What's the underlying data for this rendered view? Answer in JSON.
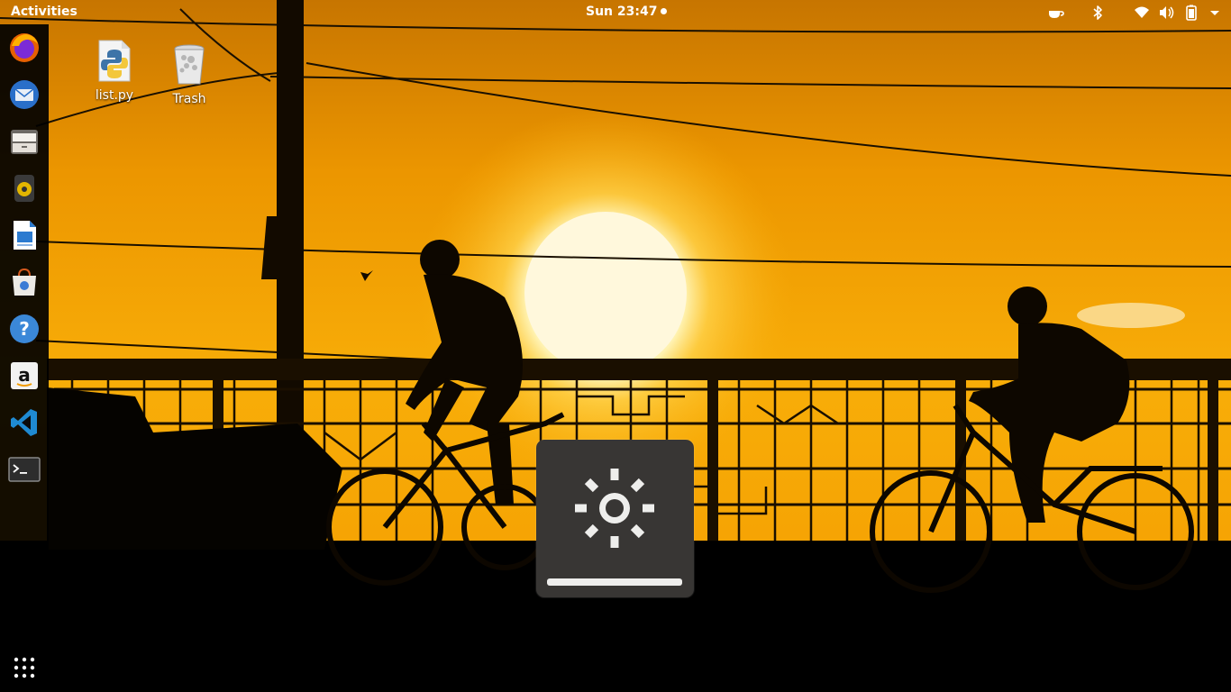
{
  "topbar": {
    "activities_label": "Activities",
    "clock": "Sun 23:47",
    "tray_icons": [
      "coffee-cup-icon",
      "bluetooth-icon",
      "wifi-icon",
      "volume-icon",
      "battery-icon",
      "system-menu-arrow-icon"
    ]
  },
  "dock": {
    "items": [
      {
        "name": "firefox",
        "icon": "firefox-icon"
      },
      {
        "name": "thunderbird",
        "icon": "thunderbird-mail-icon"
      },
      {
        "name": "files",
        "icon": "file-cabinet-icon"
      },
      {
        "name": "rhythmbox",
        "icon": "speaker-icon"
      },
      {
        "name": "libreoffice-writer",
        "icon": "document-writer-icon"
      },
      {
        "name": "software",
        "icon": "software-bag-icon"
      },
      {
        "name": "help",
        "icon": "help-question-icon"
      },
      {
        "name": "amazon",
        "icon": "amazon-icon"
      },
      {
        "name": "vscode",
        "icon": "vscode-icon"
      },
      {
        "name": "terminal",
        "icon": "terminal-icon"
      }
    ],
    "show_apps_icon": "app-grid-icon"
  },
  "desktop": {
    "icons": [
      {
        "label": "list.py",
        "icon": "python-file-icon"
      },
      {
        "label": "Trash",
        "icon": "trash-icon"
      }
    ]
  },
  "osd": {
    "type": "brightness",
    "icon": "brightness-sun-icon",
    "level": 1.0
  },
  "colors": {
    "sky_top": "#e98f00",
    "sky_mid": "#f7a800",
    "sun": "#fff6c8",
    "osd_bg": "#383634",
    "dock_bg": "#0c0c0c"
  }
}
